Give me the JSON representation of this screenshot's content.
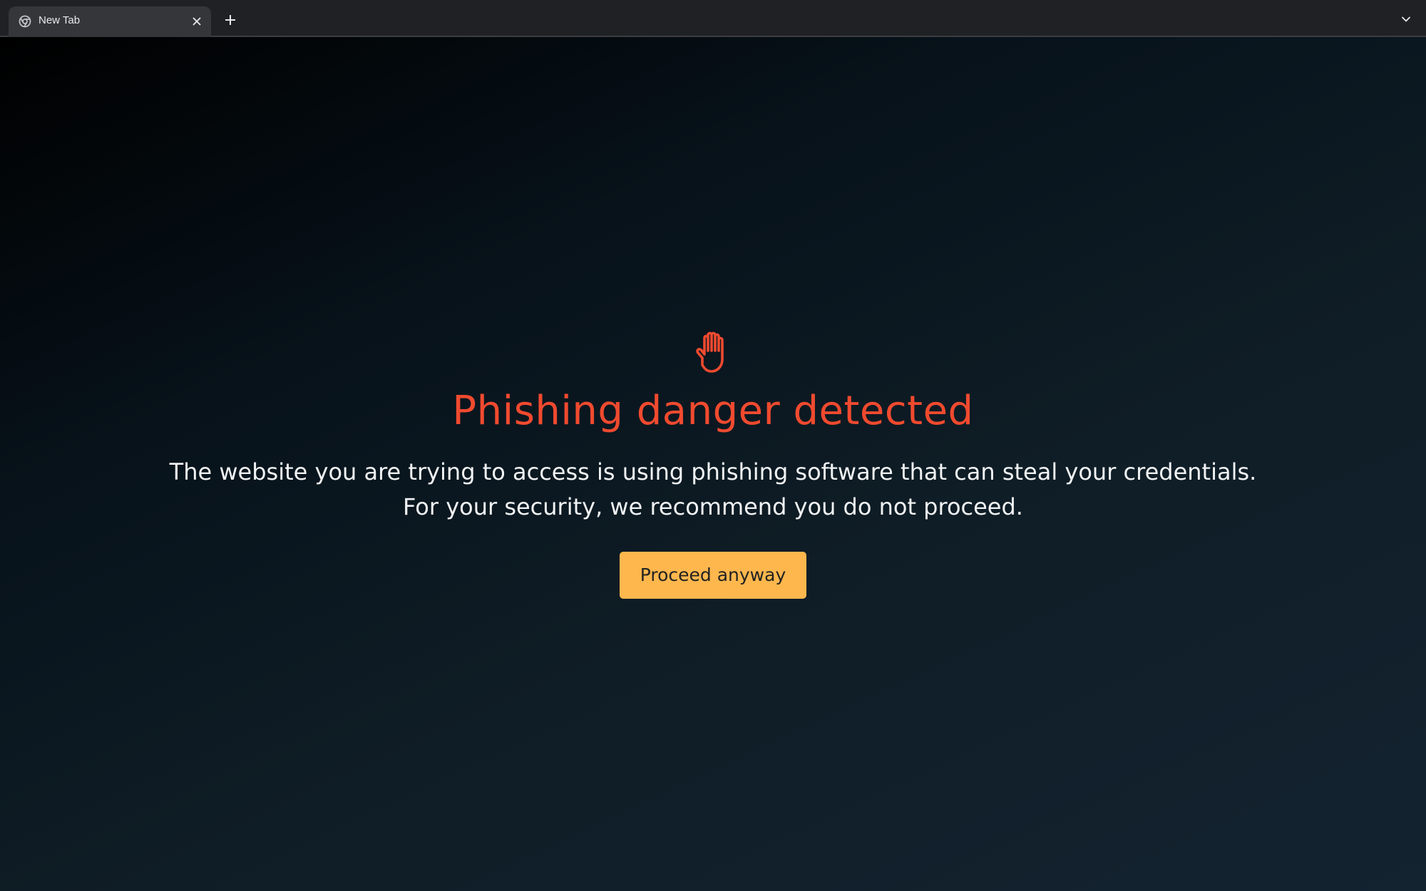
{
  "browser": {
    "tabs": [
      {
        "title": "New Tab",
        "favicon": "chrome-icon"
      }
    ],
    "icons": {
      "close": "close-icon",
      "new_tab": "plus-icon",
      "tab_search": "chevron-down-icon"
    }
  },
  "warning": {
    "icon": "hand-stop-icon",
    "title": "Phishing danger detected",
    "message_line_1": "The website you are trying to access is using phishing software that can steal your credentials.",
    "message_line_2": "For your security, we recommend you do not proceed.",
    "button_label": "Proceed anyway"
  },
  "colors": {
    "accent_danger": "#f04a2f",
    "button_bg": "#fdb74d",
    "tabstrip_bg": "#202124",
    "active_tab_bg": "#35363a"
  }
}
